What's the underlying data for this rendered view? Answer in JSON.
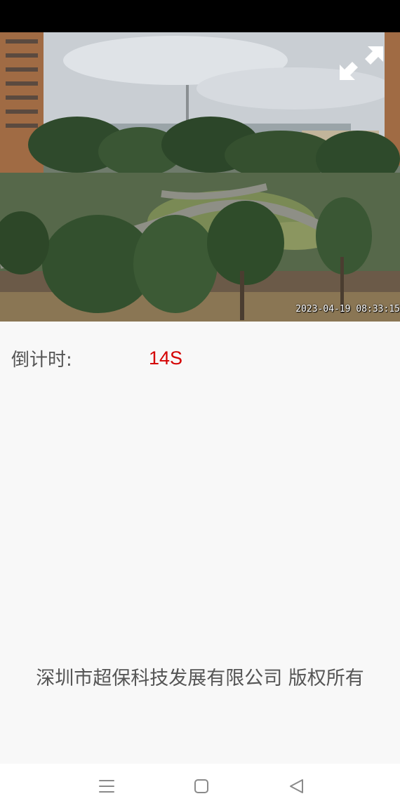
{
  "video": {
    "timestamp": "2023-04-19 08:33:15",
    "fullscreen_icon": "expand-arrows-icon"
  },
  "countdown": {
    "label": "倒计时:",
    "value": "14S"
  },
  "footer": {
    "copyright": "深圳市超保科技发展有限公司 版权所有"
  },
  "navigation": {
    "menu_icon": "menu-lines-icon",
    "home_icon": "home-square-icon",
    "back_icon": "back-triangle-icon"
  },
  "colors": {
    "background": "#f8f8f8",
    "countdown_value": "#d40000",
    "label_text": "#555555",
    "status_bar": "#000000"
  }
}
